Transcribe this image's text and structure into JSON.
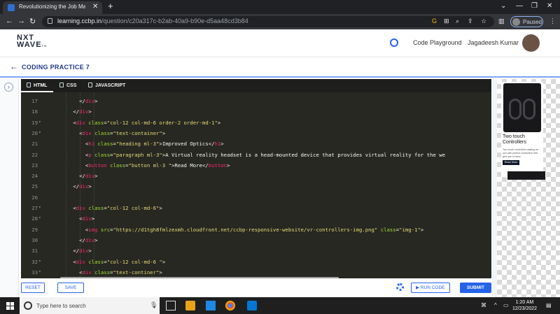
{
  "browser": {
    "tab_title": "Revolutionizing the Job Market |",
    "url_host": "learning.ccbp.in",
    "url_path": "/question/c20a317c-b2ab-40a9-b90e-d5aa48cd3b84",
    "profile_status": "Paused"
  },
  "app": {
    "logo_line1": "NXT",
    "logo_line2": "WAVE",
    "logo_suffix": "TM",
    "code_playground": "Code Playground",
    "user_name": "Jagadeesh Kumar",
    "practice_title": "CODING PRACTICE 7"
  },
  "editor_tabs": [
    {
      "label": "HTML",
      "icon": "html5-icon",
      "active": true
    },
    {
      "label": "CSS",
      "icon": "css3-icon",
      "active": false
    },
    {
      "label": "JAVASCRIPT",
      "icon": "javascript-icon",
      "active": false
    }
  ],
  "code_lines": [
    {
      "n": "17",
      "fold": "",
      "segs": [
        [
          "p",
          "        </"
        ],
        [
          "t",
          "div"
        ],
        [
          "p",
          ">"
        ]
      ]
    },
    {
      "n": "18",
      "fold": "",
      "segs": [
        [
          "p",
          "      </"
        ],
        [
          "t",
          "div"
        ],
        [
          "p",
          ">"
        ]
      ]
    },
    {
      "n": "19",
      "fold": "▾",
      "segs": [
        [
          "p",
          "      <"
        ],
        [
          "t",
          "div"
        ],
        [
          "p",
          " "
        ],
        [
          "a",
          "class"
        ],
        [
          "p",
          "="
        ],
        [
          "s",
          "\"col-12 col-md-6 order-2 order-md-1\""
        ],
        [
          "p",
          ">"
        ]
      ]
    },
    {
      "n": "20",
      "fold": "▾",
      "segs": [
        [
          "p",
          "        <"
        ],
        [
          "t",
          "div"
        ],
        [
          "p",
          " "
        ],
        [
          "a",
          "class"
        ],
        [
          "p",
          "="
        ],
        [
          "s",
          "\"text-container\""
        ],
        [
          "p",
          ">"
        ]
      ]
    },
    {
      "n": "21",
      "fold": "",
      "segs": [
        [
          "p",
          "          <"
        ],
        [
          "t",
          "h1"
        ],
        [
          "p",
          " "
        ],
        [
          "a",
          "class"
        ],
        [
          "p",
          "="
        ],
        [
          "s",
          "\"heading ml-3\""
        ],
        [
          "p",
          ">Improved Optics</"
        ],
        [
          "t",
          "h1"
        ],
        [
          "p",
          ">"
        ]
      ]
    },
    {
      "n": "22",
      "fold": "",
      "segs": [
        [
          "p",
          "          <"
        ],
        [
          "t",
          "p"
        ],
        [
          "p",
          " "
        ],
        [
          "a",
          "class"
        ],
        [
          "p",
          "="
        ],
        [
          "s",
          "\"paragraph ml-3\""
        ],
        [
          "p",
          ">A Virtual reality headset is a head-mounted device that provides virtual reality for the we"
        ]
      ]
    },
    {
      "n": "23",
      "fold": "",
      "segs": [
        [
          "p",
          "          <"
        ],
        [
          "t",
          "button"
        ],
        [
          "p",
          " "
        ],
        [
          "a",
          "class"
        ],
        [
          "p",
          "="
        ],
        [
          "s",
          "\"button ml-3 \""
        ],
        [
          "p",
          ">Read More</"
        ],
        [
          "t",
          "button"
        ],
        [
          "p",
          ">"
        ]
      ]
    },
    {
      "n": "24",
      "fold": "",
      "segs": [
        [
          "p",
          "        </"
        ],
        [
          "t",
          "div"
        ],
        [
          "p",
          ">"
        ]
      ]
    },
    {
      "n": "25",
      "fold": "",
      "segs": [
        [
          "p",
          "      </"
        ],
        [
          "t",
          "div"
        ],
        [
          "p",
          ">"
        ]
      ]
    },
    {
      "n": "26",
      "fold": "",
      "segs": []
    },
    {
      "n": "27",
      "fold": "▾",
      "segs": [
        [
          "p",
          "      <"
        ],
        [
          "t",
          "div"
        ],
        [
          "p",
          " "
        ],
        [
          "a",
          "class"
        ],
        [
          "p",
          "="
        ],
        [
          "s",
          "\"col-12 col-md-6\""
        ],
        [
          "p",
          ">"
        ]
      ]
    },
    {
      "n": "28",
      "fold": "▾",
      "segs": [
        [
          "p",
          "        <"
        ],
        [
          "t",
          "div"
        ],
        [
          "p",
          ">"
        ]
      ]
    },
    {
      "n": "29",
      "fold": "",
      "segs": [
        [
          "p",
          "          <"
        ],
        [
          "t",
          "img"
        ],
        [
          "p",
          " "
        ],
        [
          "a",
          "src"
        ],
        [
          "p",
          "="
        ],
        [
          "s",
          "\"https://d1tgh8fmlzexmh.cloudfront.net/ccbp-responsive-website/vr-controllers-img.png\""
        ],
        [
          "p",
          " "
        ],
        [
          "a",
          "class"
        ],
        [
          "p",
          "="
        ],
        [
          "s",
          "\"img-1\""
        ],
        [
          "p",
          ">"
        ]
      ]
    },
    {
      "n": "30",
      "fold": "",
      "segs": [
        [
          "p",
          "        </"
        ],
        [
          "t",
          "div"
        ],
        [
          "p",
          ">"
        ]
      ]
    },
    {
      "n": "31",
      "fold": "",
      "segs": [
        [
          "p",
          "      </"
        ],
        [
          "t",
          "div"
        ],
        [
          "p",
          ">"
        ]
      ]
    },
    {
      "n": "32",
      "fold": "▾",
      "segs": [
        [
          "p",
          "      <"
        ],
        [
          "t",
          "div"
        ],
        [
          "p",
          " "
        ],
        [
          "a",
          "class"
        ],
        [
          "p",
          "="
        ],
        [
          "s",
          "\"col-12 col-md-6 \""
        ],
        [
          "p",
          ">"
        ]
      ]
    },
    {
      "n": "33",
      "fold": "▾",
      "segs": [
        [
          "p",
          "        <"
        ],
        [
          "t",
          "div"
        ],
        [
          "p",
          " "
        ],
        [
          "a",
          "class"
        ],
        [
          "p",
          "="
        ],
        [
          "s",
          "\"text-continer\""
        ],
        [
          "p",
          ">"
        ]
      ]
    }
  ],
  "footer": {
    "reset": "RESET",
    "save": "SAVE",
    "run_code": "RUN CODE",
    "submit": "SUBMIT"
  },
  "preview": {
    "title": "Two touch Controllers",
    "text": "Two touch controllers waiting for you with perfect controllers that give you a hand.",
    "button": "Read More"
  },
  "taskbar": {
    "search_placeholder": "Type here to search",
    "time": "1:20 AM",
    "date": "12/23/2022"
  },
  "colors": {
    "accent": "#2563eb",
    "editor_bg": "#272822",
    "tag": "#f92672",
    "attr": "#a6e22e",
    "string": "#e6db74"
  }
}
